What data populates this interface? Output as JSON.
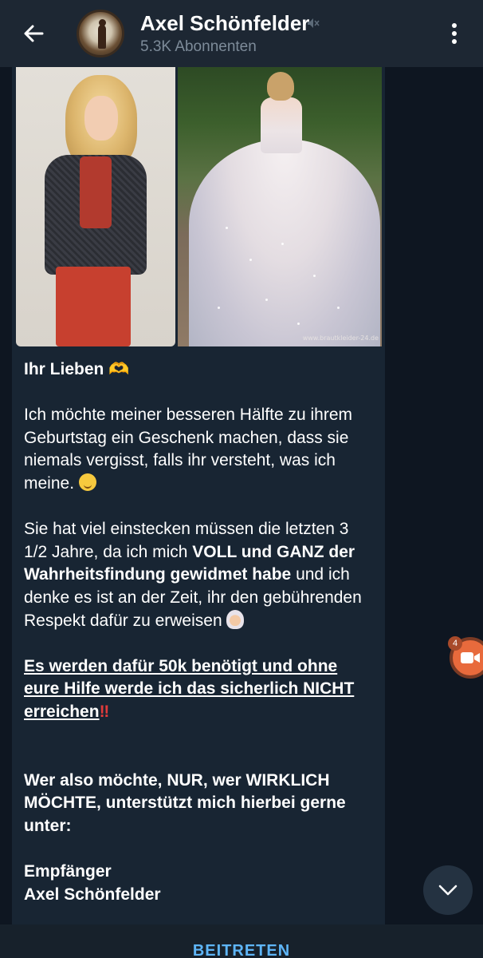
{
  "header": {
    "title": "Axel Schönfelder",
    "subscribers": "5.3K Abonnenten",
    "muted_icon": "speaker-muted-icon",
    "back_icon": "arrow-left-icon",
    "menu_icon": "more-vertical-icon"
  },
  "message": {
    "photo_watermark": "www.brautkleider-24.de",
    "greeting": "Ihr Lieben",
    "paragraph1": "Ich möchte meiner besseren Hälfte zu ihrem Geburtstag ein Geschenk machen, dass sie niemals vergisst, falls ihr versteht, was ich meine.",
    "paragraph2_pre": "Sie hat viel einstecken müssen die letzten 3 1/2 Jahre, da ich mich ",
    "paragraph2_bold": "VOLL und GANZ der Wahrheitsfindung gewidmet habe",
    "paragraph2_post": " und ich denke es ist an der Zeit, ihr den gebührenden Respekt dafür zu erweisen",
    "paragraph3_underlined": "Es werden dafür 50k benötigt und ohne eure Hilfe werde ich das sicherlich NICHT erreichen",
    "paragraph4": "Wer also möchte, NUR, wer WIRKLICH MÖCHTE, unterstützt mich hierbei gerne unter:",
    "recipient_label": "Empfänger",
    "recipient_name": "Axel Schönfelder"
  },
  "video_chat": {
    "badge_count": "4",
    "icon": "video-camera-icon"
  },
  "scroll_down_icon": "chevron-down-icon",
  "bottom": {
    "join_label": "BEITRETEN"
  },
  "colors": {
    "background": "#0e1621",
    "header": "#1d2733",
    "bubble": "#182533",
    "accent": "#5eb5f7",
    "video_chat": "#e86a3c"
  }
}
